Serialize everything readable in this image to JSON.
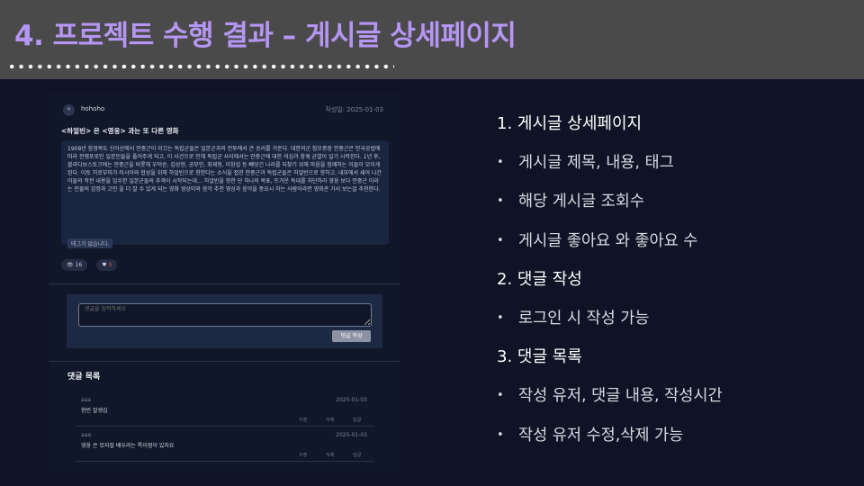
{
  "slide": {
    "title": "4. 프로젝트 수행 결과 – 게시글 상세페이지"
  },
  "screenshot": {
    "avatar_initials": "H",
    "author": "hohoho",
    "date": "작성일: 2025-01-03",
    "post_title": "<하얼빈> 은 <영웅> 과는 또 다른 영화",
    "content": "1908년 함경북도 신아산에서 안중근이 이끄는 독립군들은 일본군과의 전투에서 큰 승리를 거둔다. 대한의군 참모중장 안중근은 만국공법에 따라 전쟁포로인 일본인들을 풀어주게 되고, 이 사건으로 인해 독립군 사이에서는 안중근에 대한 의심과 함께 균열이 일기 시작한다. 1년 후, 블라디보스토크에는 안중근을 비롯해 우덕순, 김상현, 공부인, 최재형, 이창섭 등 빼앗긴 나라를 되찾기 위해 마음을 함께하는 이들이 모이게 된다. 이토 히로부미가 러시아와 협상을 위해 하얼빈으로 향한다는 소식을 접한 안중근과 독립군들은 하얼빈으로 향하고, 내부에서 새어 나간 이들의 작전 내용을 입수한 일본군들의 추격이 시작되는데… 하얼빈을 향한 단 하나의 목표, 뜨거운 독대를 처단하라 영웅 보다 안중근 이라는 인물의 감정과 고민 을 더 잘 수 있게 되는 영화 영상미와 음악 추천 영상과 음악을 중요시 하는 사람이라면 영화관 가서 보는걸 추천한다.",
    "tag": "태그가 없습니다.",
    "views": "16",
    "likes": "0",
    "comment_placeholder": "댓글을 입력하세요",
    "submit_label": "댓글 작성",
    "comments_title": "댓글 목록",
    "comments": [
      {
        "user": "aaa",
        "date": "2025-01-03",
        "text": "현빈 잘생김",
        "edit": "수정",
        "delete": "삭제",
        "reply": "답글"
      },
      {
        "user": "aaa",
        "date": "2025-01-03",
        "text": "영웅 은 뮤지컬 배우라는 특이점이 있지요",
        "edit": "수정",
        "delete": "삭제",
        "reply": "답글"
      }
    ]
  },
  "bullets": [
    {
      "text": "1.  게시글 상세페이지",
      "level": 1
    },
    {
      "text": "게시글 제목, 내용, 태그",
      "level": 2
    },
    {
      "text": "해당 게시글 조회수",
      "level": 2
    },
    {
      "text": "게시글 좋아요 와 좋아요 수",
      "level": 2
    },
    {
      "text": "2. 댓글 작성",
      "level": 1
    },
    {
      "text": "로그인 시 작성 가능",
      "level": 2
    },
    {
      "text": "3. 댓글 목록",
      "level": 1
    },
    {
      "text": "작성 유저, 댓글 내용, 작성시간",
      "level": 2
    },
    {
      "text": "작성 유저 수정,삭제 가능",
      "level": 2
    }
  ],
  "colors": {
    "title": "#b596f2",
    "header_bg": "#4a4a4a",
    "slide_bg": "#0e1425"
  }
}
